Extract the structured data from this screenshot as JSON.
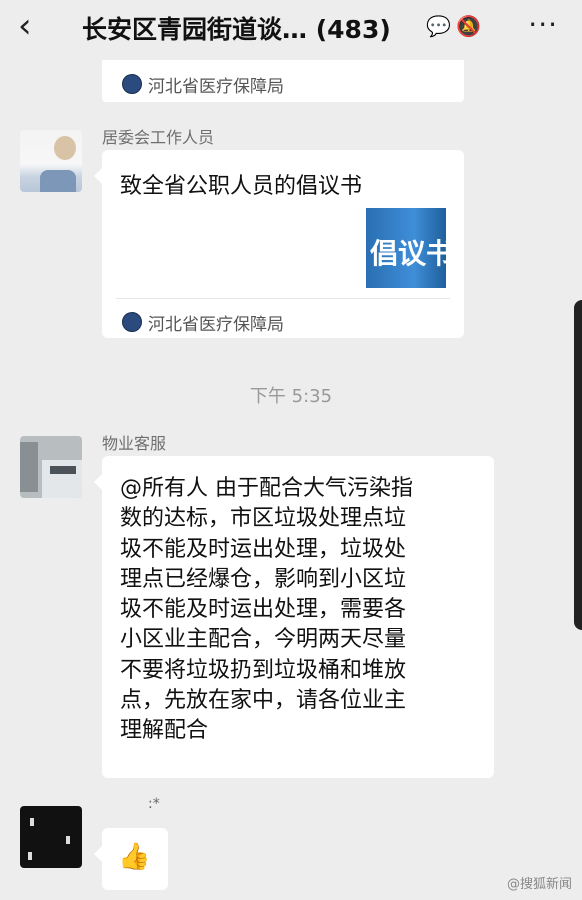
{
  "header": {
    "back_icon": "back-arrow-icon",
    "title": "长安区青园街道谈…",
    "count": "(483)",
    "icons": [
      "chat-bubble-icon",
      "mute-bell-icon"
    ],
    "more_icon": "more-dots-icon"
  },
  "messages": [
    {
      "source": "河北省医疗保障局"
    },
    {
      "sender": "居委会工作人员",
      "card_title": "致全省公职人员的倡议书",
      "thumb_text": "倡议书",
      "source": "河北省医疗保障局"
    },
    {
      "time": "下午 5:35"
    },
    {
      "sender": "物业客服",
      "text": "@所有人 由于配合大气污染指\n数的达标，市区垃圾处理点垃\n圾不能及时运出处理，垃圾处\n理点已经爆仓，影响到小区垃\n圾不能及时运出处理，需要各\n小区业主配合，今明两天尽量\n不要将垃圾扔到垃圾桶和堆放\n点，先放在家中，请各位业主\n理解配合"
    },
    {
      "sender": ":*",
      "emoji": "👍"
    }
  ],
  "watermark": "@搜狐新闻",
  "colors": {
    "bg": "#ededed",
    "bubble": "#ffffff",
    "accent": "#5aa7ff"
  }
}
